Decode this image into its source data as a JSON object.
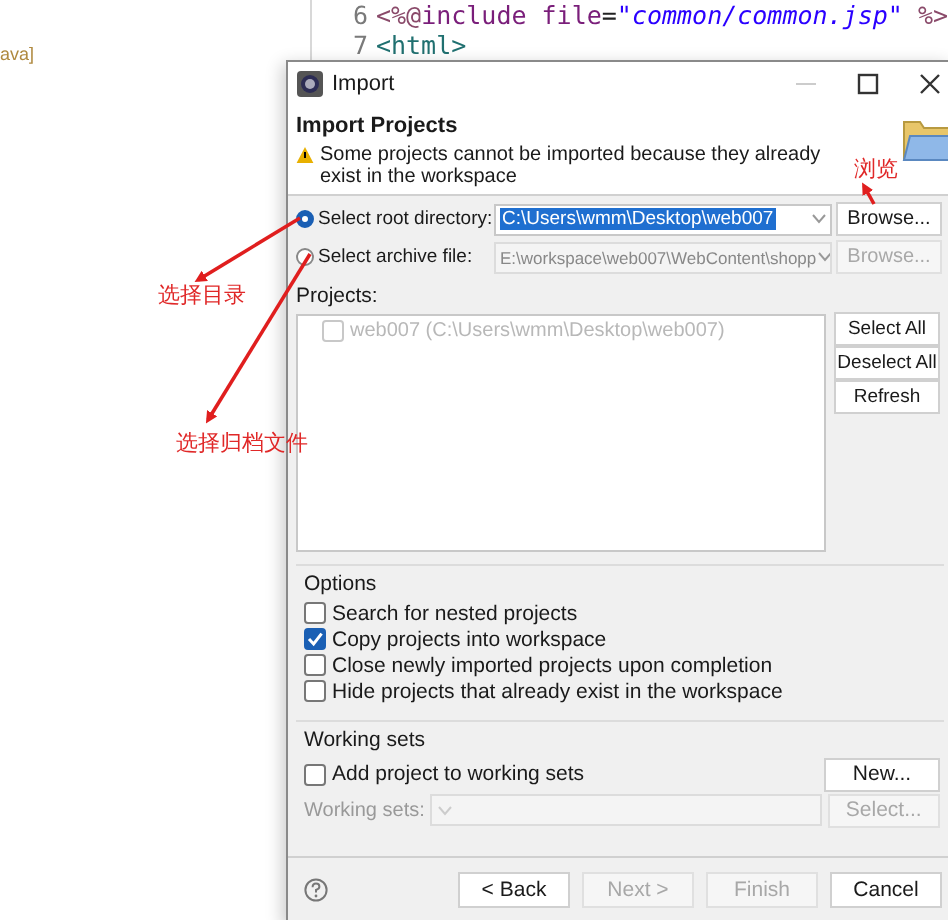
{
  "background": {
    "sidebar_text": "ava]",
    "editor_lines": [
      {
        "number": "6",
        "tokens": [
          {
            "text": "<%@",
            "kind": "delim"
          },
          {
            "text": "include",
            "kind": "keyword"
          },
          {
            "text": " file",
            "kind": "attr"
          },
          {
            "text": "=",
            "kind": "plain"
          },
          {
            "text": "\"common/common.jsp\"",
            "kind": "string"
          },
          {
            "text": " %>",
            "kind": "delim"
          }
        ]
      },
      {
        "number": "7",
        "tokens": [
          {
            "text": "<html>",
            "kind": "tag"
          }
        ]
      }
    ]
  },
  "dialog": {
    "title": "Import",
    "heading": "Import Projects",
    "warning": "Some projects cannot be imported because they already exist in the workspace",
    "sources": [
      {
        "label": "Select root directory:",
        "selected": true,
        "value": "C:\\Users\\wmm\\Desktop\\web007",
        "text_selected": true,
        "disabled": false,
        "browse": "Browse..."
      },
      {
        "label": "Select archive file:",
        "selected": false,
        "value": "E:\\workspace\\web007\\WebContent\\shopp",
        "text_selected": false,
        "disabled": true,
        "browse": "Browse..."
      }
    ],
    "projects_label": "Projects:",
    "projects": [
      {
        "label": "web007 (C:\\Users\\wmm\\Desktop\\web007)",
        "checked": false,
        "disabled": true
      }
    ],
    "project_buttons": [
      "Select All",
      "Deselect All",
      "Refresh"
    ],
    "options_title": "Options",
    "options": [
      {
        "label": "Search for nested projects",
        "checked": false
      },
      {
        "label": "Copy projects into workspace",
        "checked": true
      },
      {
        "label": "Close newly imported projects upon completion",
        "checked": false
      },
      {
        "label": "Hide projects that already exist in the workspace",
        "checked": false
      }
    ],
    "working_sets_title": "Working sets",
    "add_to_working_sets": {
      "label": "Add project to working sets",
      "checked": false
    },
    "new_button": "New...",
    "working_sets_field": {
      "label": "Working sets:",
      "disabled": true
    },
    "select_button": {
      "label": "Select...",
      "disabled": true
    },
    "buttons": [
      {
        "label": "< Back",
        "disabled": false
      },
      {
        "label": "Next >",
        "disabled": true
      },
      {
        "label": "Finish",
        "disabled": true
      },
      {
        "label": "Cancel",
        "disabled": false
      }
    ]
  },
  "annotations": [
    {
      "text": "浏览"
    },
    {
      "text": "选择目录"
    },
    {
      "text": "选择归档文件"
    }
  ]
}
